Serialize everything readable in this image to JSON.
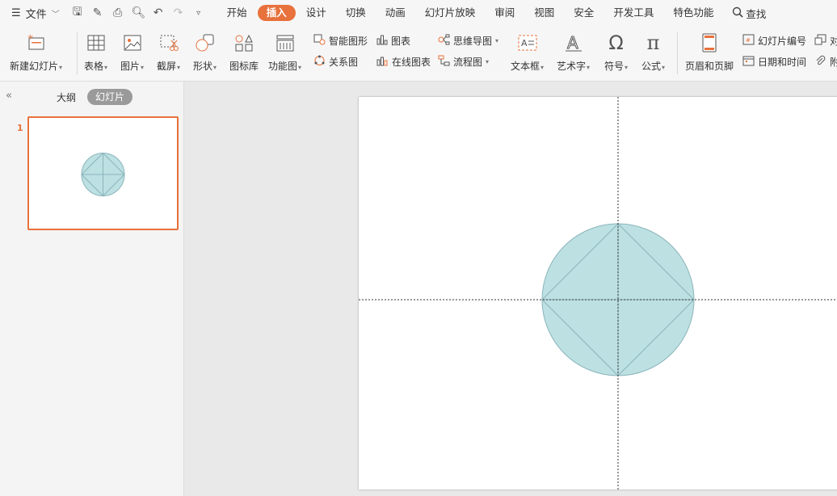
{
  "menubar": {
    "file_label": "文件",
    "tabs": [
      "开始",
      "插入",
      "设计",
      "切换",
      "动画",
      "幻灯片放映",
      "审阅",
      "视图",
      "安全",
      "开发工具",
      "特色功能"
    ],
    "active_tab": "插入",
    "search_label": "查找"
  },
  "ribbon": {
    "new_slide": "新建幻灯片",
    "table": "表格",
    "picture": "图片",
    "screenshot": "截屏",
    "shape": "形状",
    "icon_library": "图标库",
    "function_chart": "功能图",
    "smart_shape": "智能图形",
    "chart": "图表",
    "mind_map": "思维导图",
    "relation_chart": "关系图",
    "online_chart": "在线图表",
    "flowchart": "流程图",
    "textbox": "文本框",
    "art_text": "艺术字",
    "symbol": "符号",
    "formula": "公式",
    "header_footer": "页眉和页脚",
    "slide_number": "幻灯片编号",
    "date_time": "日期和时间",
    "object_partial": "对",
    "attachment_partial": "附"
  },
  "panel": {
    "outline_label": "大纲",
    "slides_label": "幻灯片",
    "slide_number": "1"
  },
  "colors": {
    "accent": "#e8713c",
    "circle_fill": "#bde0e3",
    "circle_stroke": "#8ab5ba"
  }
}
